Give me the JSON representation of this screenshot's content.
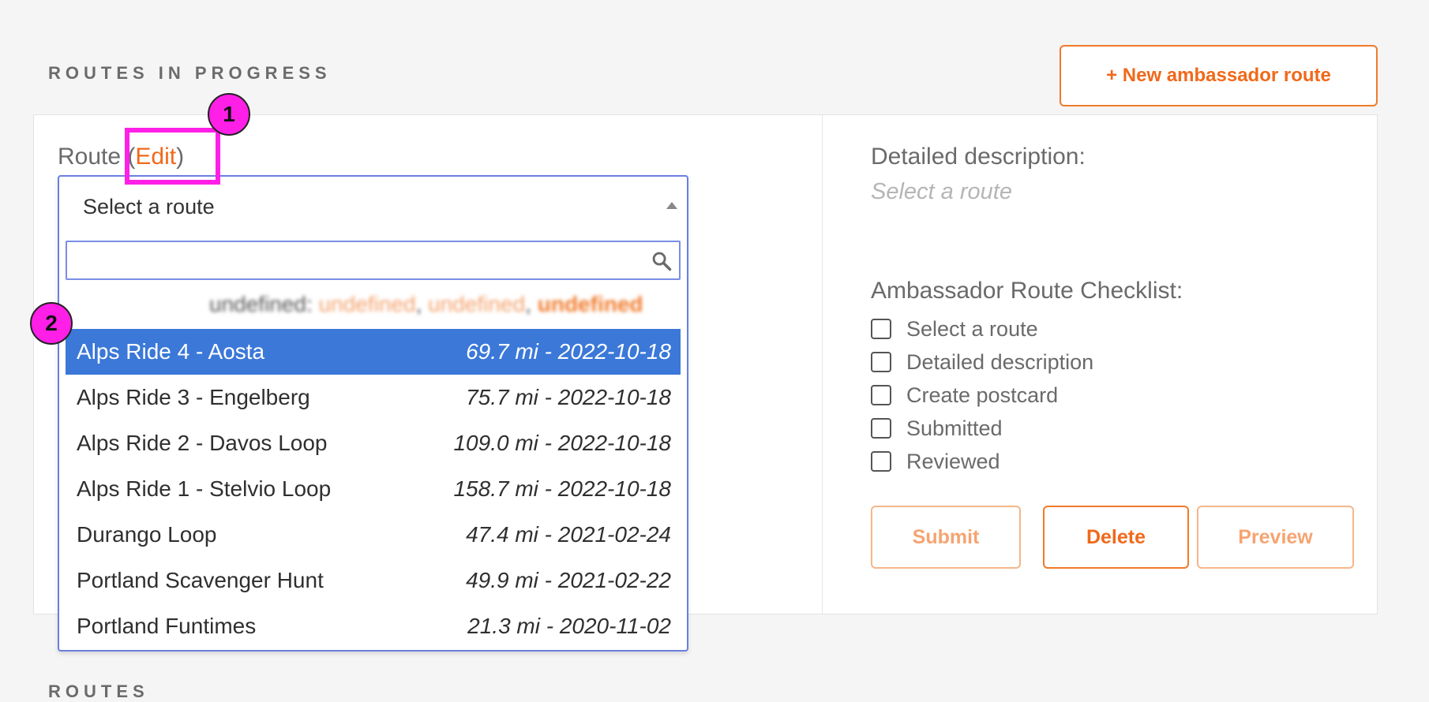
{
  "header": {
    "section_title": "ROUTES IN PROGRESS",
    "new_route_button": "+ New ambassador route"
  },
  "route_field": {
    "label": "Route",
    "paren_open": "(",
    "edit_link": "Edit",
    "paren_close": ")"
  },
  "select": {
    "placeholder": "Select a route",
    "search_value": "",
    "blurred_header": {
      "part1": "undefined",
      "part2": "undefined",
      "part3": "undefined",
      "part4": "undefined"
    },
    "options": [
      {
        "name": "Alps Ride 4 - Aosta",
        "meta": "69.7 mi - 2022-10-18",
        "highlighted": true
      },
      {
        "name": "Alps Ride 3 - Engelberg",
        "meta": "75.7 mi - 2022-10-18"
      },
      {
        "name": "Alps Ride 2 - Davos Loop",
        "meta": "109.0 mi - 2022-10-18"
      },
      {
        "name": "Alps Ride 1 - Stelvio Loop",
        "meta": "158.7 mi - 2022-10-18"
      },
      {
        "name": "Durango Loop",
        "meta": "47.4 mi - 2021-02-24"
      },
      {
        "name": "Portland Scavenger Hunt",
        "meta": "49.9 mi - 2021-02-22"
      },
      {
        "name": "Portland Funtimes",
        "meta": "21.3 mi - 2020-11-02"
      }
    ]
  },
  "detail": {
    "title": "Detailed description:",
    "value": "Select a route"
  },
  "checklist": {
    "title": "Ambassador Route Checklist:",
    "items": [
      "Select a route",
      "Detailed description",
      "Create postcard",
      "Submitted",
      "Reviewed"
    ]
  },
  "actions": {
    "submit": "Submit",
    "delete": "Delete",
    "preview": "Preview"
  },
  "footer": {
    "section_title": "ROUTES"
  },
  "annotations": {
    "marker1": "1",
    "marker2": "2"
  },
  "colors": {
    "accent": "#f0691a",
    "highlight": "#3b78d8",
    "annotation": "#ff1fe6"
  }
}
